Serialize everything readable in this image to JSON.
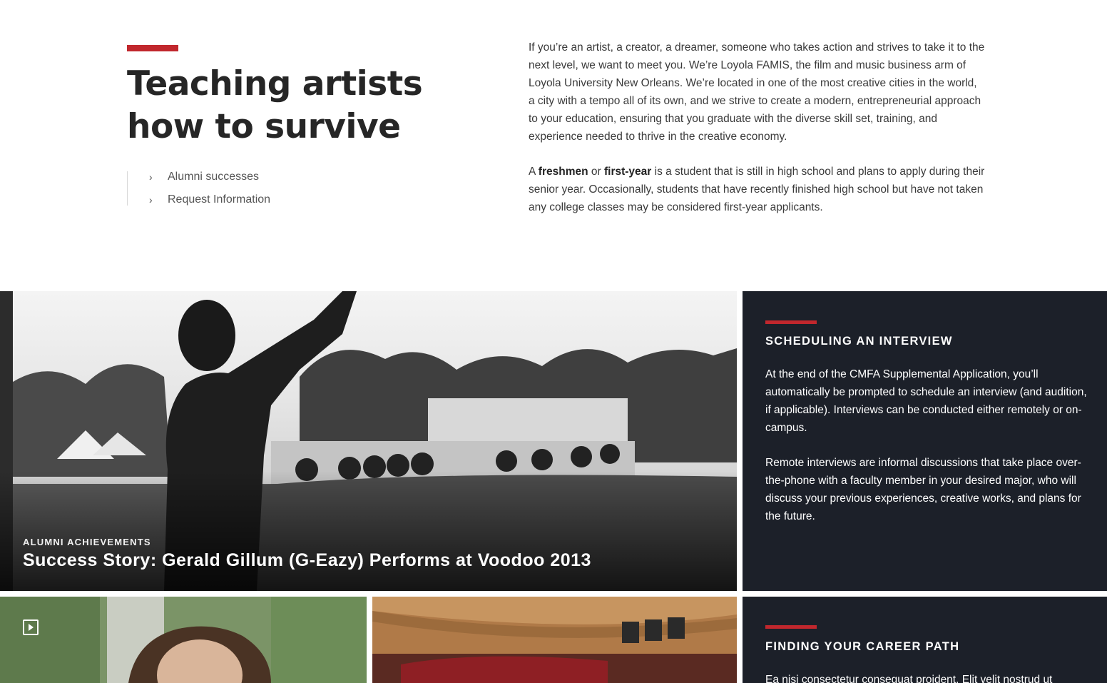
{
  "intro": {
    "title_line1": "Teaching artists",
    "title_line2": "how to survive",
    "links": [
      {
        "label": "Alumni successes"
      },
      {
        "label": "Request Information"
      }
    ],
    "paragraph1": "If you’re an artist, a creator, a dreamer, someone who takes action and strives to take it to the next level, we want to meet you.  We’re Loyola FAMIS, the film and music business arm of Loyola University New Orleans.  We’re located in one of the most creative cities in the world, a city with a tempo all of its own, and we strive to create a modern, entrepreneurial approach to your education, ensuring that you graduate with the diverse skill set, training, and experience needed to thrive in the creative economy.",
    "paragraph2": {
      "pre": "A ",
      "bold1": "freshmen",
      "mid": " or ",
      "bold2": "first-year",
      "post": " is a student that is still in high school and plans to apply during their senior year.  Occasionally, students that have recently finished high school but have not taken any college classes may be considered first-year applicants."
    }
  },
  "hero": {
    "kicker": "ALUMNI ACHIEVEMENTS",
    "title": "Success Story: Gerald Gillum (G-Eazy) Performs at Voodoo 2013"
  },
  "panels": [
    {
      "heading": "SCHEDULING AN INTERVIEW",
      "paragraphs": [
        "At the end of the CMFA Supplemental Application, you’ll automatically be prompted to schedule an interview (and audition, if applicable). Interviews can be conducted either remotely or on-campus.",
        "Remote interviews are informal discussions that take place over-the-phone with a faculty member in your desired major, who will discuss your previous experiences, creative works, and plans for the future."
      ]
    },
    {
      "heading": "FINDING YOUR CAREER PATH",
      "paragraphs": [
        "Ea nisi consectetur consequat proident. Elit velit nostrud ut"
      ]
    }
  ],
  "colors": {
    "accent": "#c1272d",
    "panel_bg": "#1c2029"
  },
  "icons": {
    "link_chevron": "chevron-right-icon",
    "video": "play-icon"
  }
}
